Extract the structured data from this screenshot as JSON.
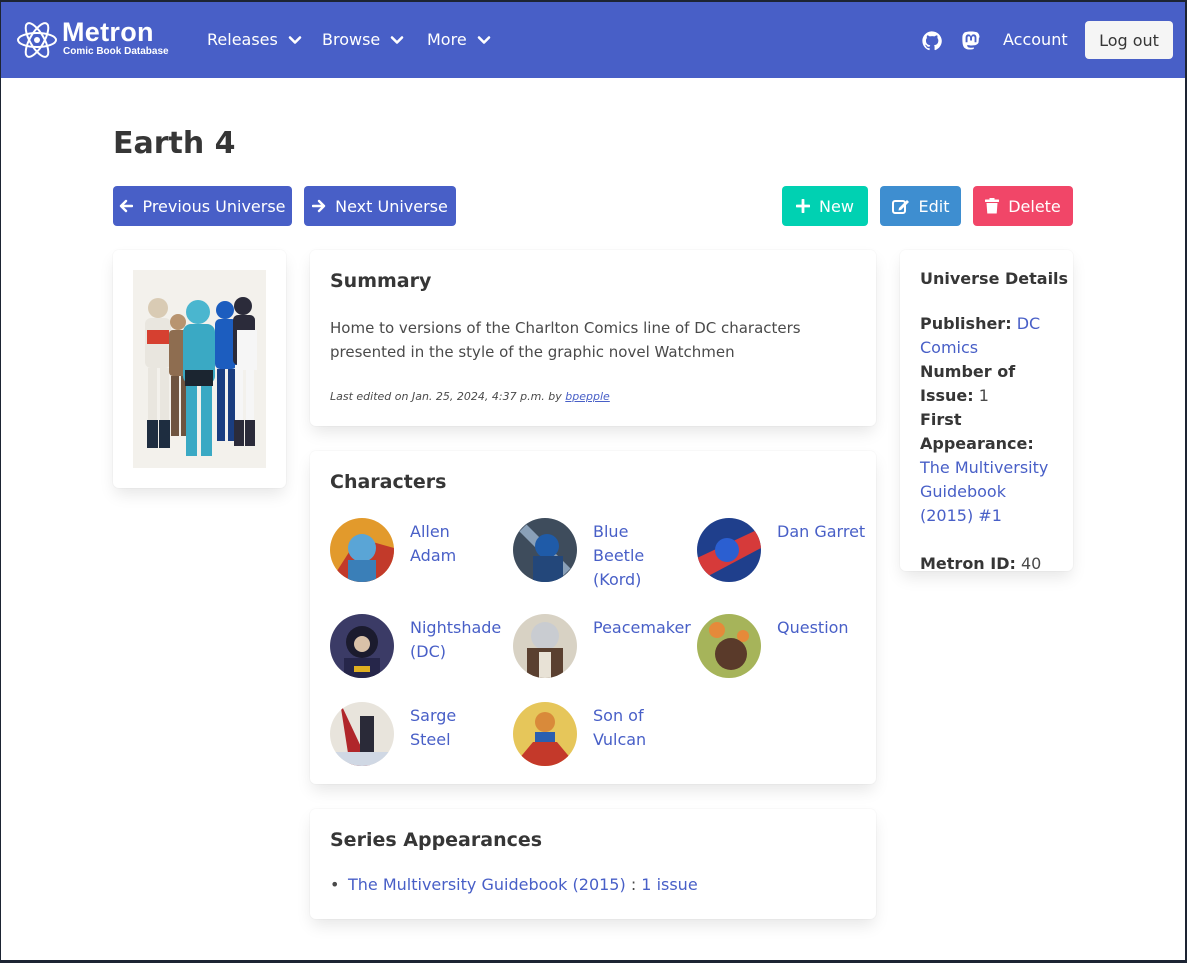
{
  "navbar": {
    "logo_main": "Metron",
    "logo_sub": "Comic Book Database",
    "menu": [
      {
        "label": "Releases"
      },
      {
        "label": "Browse"
      },
      {
        "label": "More"
      }
    ],
    "icons": [
      "github-icon",
      "mastodon-icon"
    ],
    "account_label": "Account",
    "logout_label": "Log out",
    "bg_color": "#485fc7"
  },
  "page": {
    "title": "Earth 4"
  },
  "actions": {
    "previous_label": "Previous Universe",
    "next_label": "Next Universe",
    "new_label": "New",
    "edit_label": "Edit",
    "delete_label": "Delete",
    "colors": {
      "nav": "#485fc7",
      "new": "#00d1b2",
      "edit": "#3e8ed0",
      "delete": "#f14668"
    }
  },
  "summary": {
    "heading": "Summary",
    "text": "Home to versions of the Charlton Comics line of DC characters presented in the style of the graphic novel Watchmen",
    "edited_prefix": "Last edited on Jan. 25, 2024, 4:37 p.m. by",
    "edited_user": "bpepple"
  },
  "characters": {
    "heading": "Characters",
    "items": [
      {
        "name": "Allen Adam"
      },
      {
        "name": "Blue Beetle (Kord)"
      },
      {
        "name": "Dan Garret"
      },
      {
        "name": "Nightshade (DC)"
      },
      {
        "name": "Peacemaker"
      },
      {
        "name": "Question"
      },
      {
        "name": "Sarge Steel"
      },
      {
        "name": "Son of Vulcan"
      }
    ]
  },
  "series": {
    "heading": "Series Appearances",
    "items": [
      {
        "title": "The Multiversity Guidebook (2015)",
        "separator": " : ",
        "count": "1 issue"
      }
    ]
  },
  "details": {
    "heading": "Universe Details",
    "publisher_label": "Publisher:",
    "publisher_value": "DC Comics",
    "issues_label": "Number of Issue:",
    "issues_value": "1",
    "first_label": "First Appearance:",
    "first_value": "The Multiversity Guidebook (2015) #1",
    "id_label": "Metron ID:",
    "id_value": "40"
  }
}
